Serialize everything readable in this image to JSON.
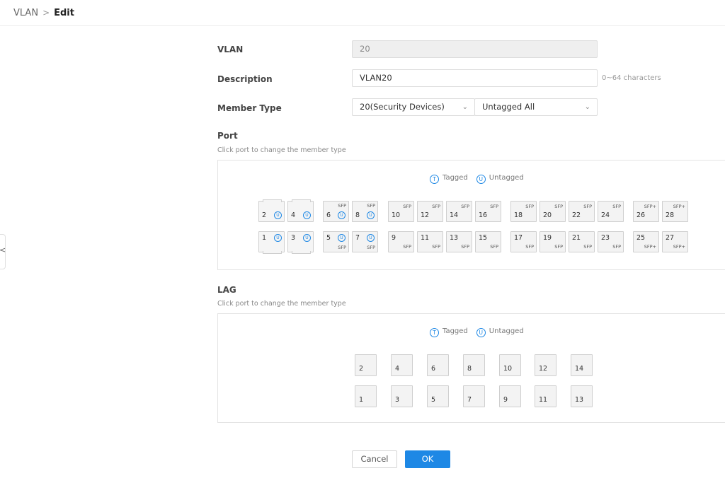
{
  "breadcrumb": {
    "root": "VLAN",
    "separator": ">",
    "current": "Edit"
  },
  "collapse_glyph": "<",
  "form": {
    "vlan_label": "VLAN",
    "vlan_value": "20",
    "description_label": "Description",
    "description_value": "VLAN20",
    "description_hint": "0~64 characters",
    "member_type_label": "Member Type",
    "member_type_vlan": "20(Security Devices)",
    "member_type_mode": "Untagged All"
  },
  "legend": {
    "tagged_badge": "T",
    "tagged": "Tagged",
    "untagged_badge": "U",
    "untagged": "Untagged"
  },
  "port_section": {
    "title": "Port",
    "hint": "Click port to change the member type",
    "ports": [
      {
        "num": "2",
        "label": "",
        "untagged": true,
        "kind": "rj"
      },
      {
        "num": "4",
        "label": "",
        "untagged": true,
        "kind": "rj"
      },
      {
        "num": "6",
        "label": "SFP",
        "untagged": true,
        "kind": "sfp"
      },
      {
        "num": "8",
        "label": "SFP",
        "untagged": true,
        "kind": "sfp"
      },
      {
        "num": "10",
        "label": "SFP",
        "untagged": false,
        "kind": "sfp"
      },
      {
        "num": "12",
        "label": "SFP",
        "untagged": false,
        "kind": "sfp"
      },
      {
        "num": "14",
        "label": "SFP",
        "untagged": false,
        "kind": "sfp"
      },
      {
        "num": "16",
        "label": "SFP",
        "untagged": false,
        "kind": "sfp"
      },
      {
        "num": "18",
        "label": "SFP",
        "untagged": false,
        "kind": "sfp"
      },
      {
        "num": "20",
        "label": "SFP",
        "untagged": false,
        "kind": "sfp"
      },
      {
        "num": "22",
        "label": "SFP",
        "untagged": false,
        "kind": "sfp"
      },
      {
        "num": "24",
        "label": "SFP",
        "untagged": false,
        "kind": "sfp"
      },
      {
        "num": "26",
        "label": "SFP+",
        "untagged": false,
        "kind": "sfp"
      },
      {
        "num": "28",
        "label": "SFP+",
        "untagged": false,
        "kind": "sfp"
      },
      {
        "num": "1",
        "label": "",
        "untagged": true,
        "kind": "rj"
      },
      {
        "num": "3",
        "label": "",
        "untagged": true,
        "kind": "rj"
      },
      {
        "num": "5",
        "label": "SFP",
        "untagged": true,
        "kind": "sfp"
      },
      {
        "num": "7",
        "label": "SFP",
        "untagged": true,
        "kind": "sfp"
      },
      {
        "num": "9",
        "label": "SFP",
        "untagged": false,
        "kind": "sfp"
      },
      {
        "num": "11",
        "label": "SFP",
        "untagged": false,
        "kind": "sfp"
      },
      {
        "num": "13",
        "label": "SFP",
        "untagged": false,
        "kind": "sfp"
      },
      {
        "num": "15",
        "label": "SFP",
        "untagged": false,
        "kind": "sfp"
      },
      {
        "num": "17",
        "label": "SFP",
        "untagged": false,
        "kind": "sfp"
      },
      {
        "num": "19",
        "label": "SFP",
        "untagged": false,
        "kind": "sfp"
      },
      {
        "num": "21",
        "label": "SFP",
        "untagged": false,
        "kind": "sfp"
      },
      {
        "num": "23",
        "label": "SFP",
        "untagged": false,
        "kind": "sfp"
      },
      {
        "num": "25",
        "label": "SFP+",
        "untagged": false,
        "kind": "sfp"
      },
      {
        "num": "27",
        "label": "SFP+",
        "untagged": false,
        "kind": "sfp"
      }
    ]
  },
  "lag_section": {
    "title": "LAG",
    "hint": "Click port to change the member type",
    "ports": [
      "2",
      "4",
      "6",
      "8",
      "10",
      "12",
      "14",
      "1",
      "3",
      "5",
      "7",
      "9",
      "11",
      "13"
    ]
  },
  "actions": {
    "cancel": "Cancel",
    "ok": "OK"
  },
  "colors": {
    "accent": "#1e88e5",
    "panel_border": "#e4e4e4"
  }
}
